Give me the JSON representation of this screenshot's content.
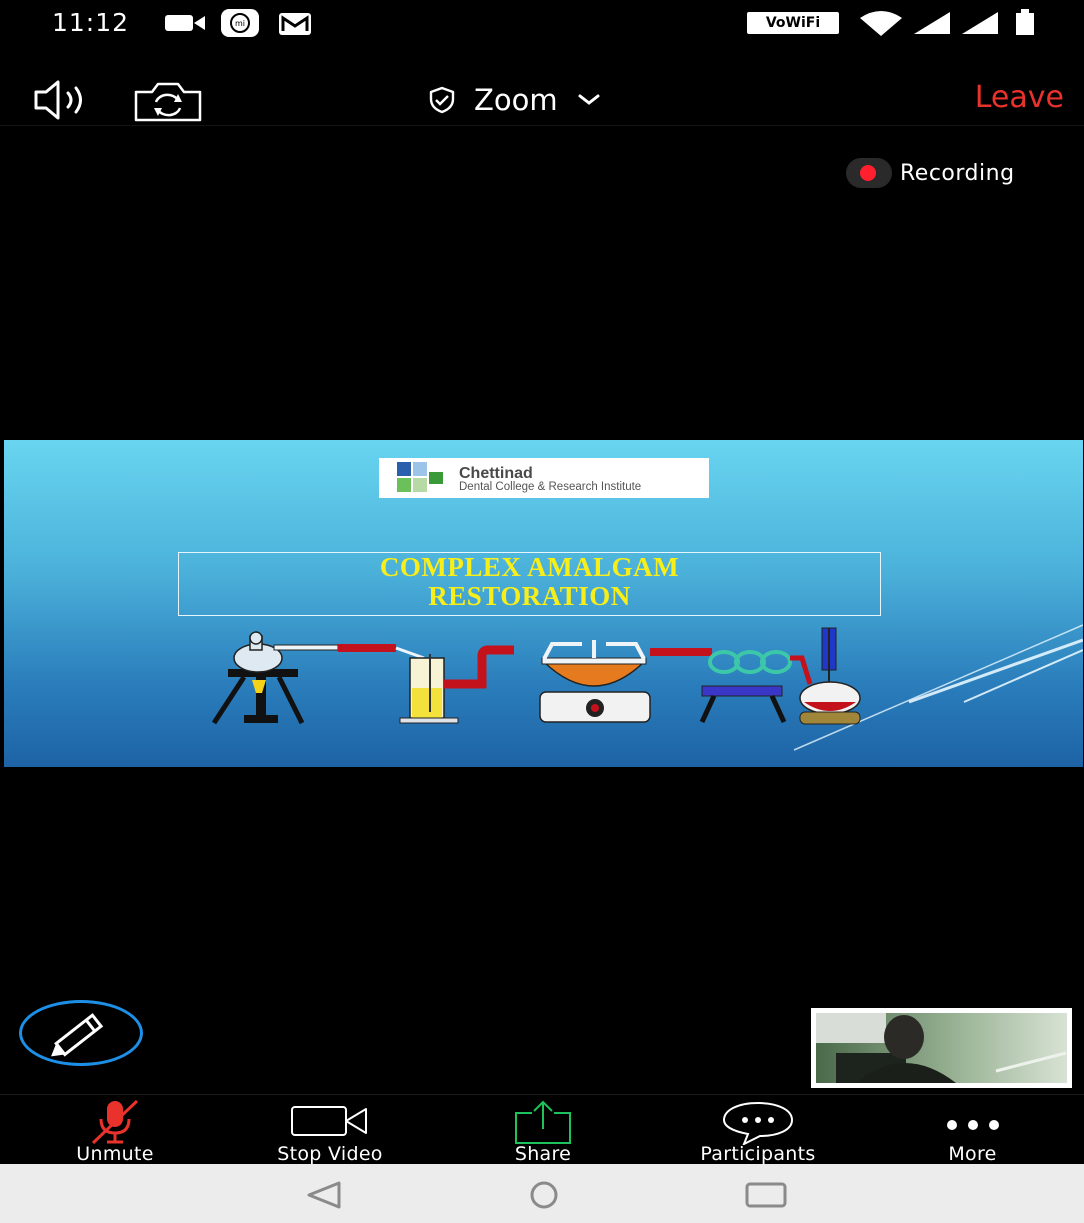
{
  "status_bar": {
    "time": "11:12",
    "network_badge": "VoWiFi",
    "icons": [
      "video-notification-icon",
      "mi-app-icon",
      "gmail-icon",
      "wifi-icon",
      "signal-icon",
      "signal-icon",
      "battery-icon"
    ]
  },
  "toolbar": {
    "meeting_title": "Zoom",
    "leave_label": "Leave",
    "leave_color": "#e8322b"
  },
  "recording": {
    "label": "Recording",
    "dot_color": "#ff1f2e"
  },
  "slide": {
    "logo_name": "Chettinad",
    "logo_subtitle": "Dental College & Research Institute",
    "title_line1": "COMPLEX AMALGAM",
    "title_line2": "RESTORATION",
    "title_color": "#f8ee1a"
  },
  "controls": {
    "unmute_label": "Unmute",
    "stop_video_label": "Stop Video",
    "share_label": "Share",
    "participants_label": "Participants",
    "more_label": "More",
    "unmute_color": "#e8322b",
    "share_color": "#1ec25a"
  },
  "nav": {
    "icons": [
      "back-icon",
      "home-icon",
      "recents-icon"
    ]
  }
}
